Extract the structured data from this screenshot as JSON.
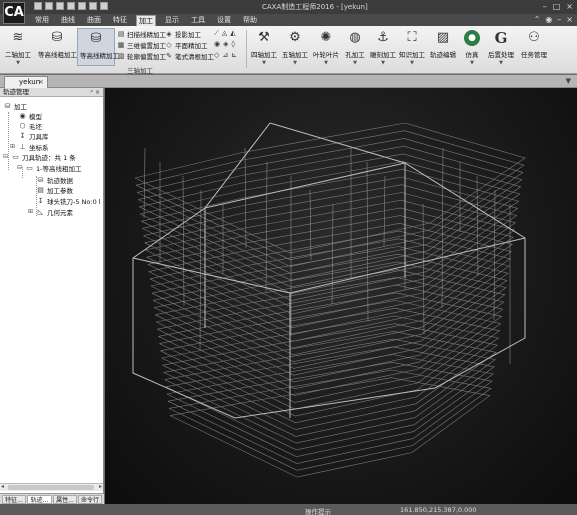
{
  "app": {
    "logo": "CA",
    "title": "CAXA制造工程师2016 - [yekun]",
    "window_controls": [
      "–",
      "□",
      "×"
    ]
  },
  "menu": {
    "tabs": [
      "常用",
      "曲线",
      "曲面",
      "特征",
      "加工",
      "显示",
      "工具",
      "设置",
      "帮助"
    ],
    "active": "加工",
    "right_controls": [
      "⌃",
      "◉",
      "–",
      "×"
    ]
  },
  "ribbon": {
    "buttons": {
      "two_axis": "二轴加工",
      "contour_rough": "等高线粗加工",
      "contour_finish": "等高线精加工",
      "four_axis": "四轴加工",
      "five_axis": "五轴加工",
      "blade": "叶轮叶片",
      "hole": "孔加工",
      "engrave": "雕刻加工",
      "knowledge": "知识加工",
      "path_edit": "轨迹编辑",
      "simulate": "仿真",
      "post": "后置处理",
      "task": "任务管理"
    },
    "small_buttons": {
      "scan_finish": "扫描线精加工",
      "trim_rough": "三维偏置加工",
      "offset_finish": "轮廓偏置加工",
      "projection": "投影加工",
      "plane_finish": "平面精加工",
      "pencil": "笔式清根加工"
    },
    "group_label": "三轴加工"
  },
  "doc": {
    "tab_label": "yekun",
    "tab_close": "×",
    "nav_arrow": "▼"
  },
  "panel": {
    "title": "轨迹管理",
    "head_buttons": "ᵖ ×",
    "tree": {
      "root": "加工",
      "model": "模型",
      "blank": "毛坯",
      "toolbase": "刀具库",
      "coords": "坐标系",
      "paths": "刀具轨迹：共 1 条",
      "op": "1-等高线粗加工",
      "path_data": "轨迹数据",
      "params": "加工参数",
      "tool": "球头铣刀-5 No:0 l",
      "geometry": "几何元素"
    },
    "bottom_tabs": [
      "特征...",
      "轨迹...",
      "属性...",
      "命令行"
    ],
    "active_tab": "轨迹..."
  },
  "status": {
    "hint": "操作提示",
    "coord": "161.850,215.387,0.000"
  }
}
